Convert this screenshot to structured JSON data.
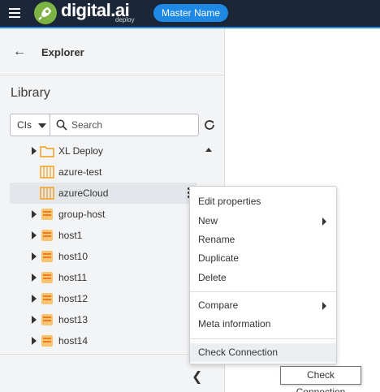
{
  "topbar": {
    "brand": "digital.ai",
    "brand_sub": "deploy",
    "master_name": "Master Name",
    "menu_icon": "hamburger-menu-icon",
    "colors": {
      "bar": "#1b2638",
      "accent": "#1e88e5",
      "brand_green": "#7cb342"
    }
  },
  "explorer": {
    "back_icon": "back-arrow-icon",
    "title": "Explorer"
  },
  "library": {
    "title": "Library",
    "filter_selected": "CIs",
    "search_placeholder": "Search",
    "refresh_icon": "refresh-icon"
  },
  "tree": {
    "items": [
      {
        "label": "XL Deploy",
        "icon": "folder-icon",
        "expandable": true
      },
      {
        "label": "azure-test",
        "icon": "infrastructure-icon",
        "expandable": false
      },
      {
        "label": "azureCloud",
        "icon": "infrastructure-icon",
        "expandable": false,
        "selected": true
      },
      {
        "label": "group-host",
        "icon": "host-icon",
        "expandable": true
      },
      {
        "label": "host1",
        "icon": "host-icon",
        "expandable": true
      },
      {
        "label": "host10",
        "icon": "host-icon",
        "expandable": true
      },
      {
        "label": "host11",
        "icon": "host-icon",
        "expandable": true
      },
      {
        "label": "host12",
        "icon": "host-icon",
        "expandable": true
      },
      {
        "label": "host13",
        "icon": "host-icon",
        "expandable": true
      },
      {
        "label": "host14",
        "icon": "host-icon",
        "expandable": true
      }
    ]
  },
  "context_menu": {
    "items": [
      {
        "label": "Edit properties"
      },
      {
        "label": "New",
        "submenu": true
      },
      {
        "label": "Rename"
      },
      {
        "label": "Duplicate"
      },
      {
        "label": "Delete"
      },
      {
        "label": "Compare",
        "submenu": true
      },
      {
        "label": "Meta information"
      },
      {
        "label": "Check Connection"
      }
    ]
  },
  "tooltip": {
    "text": "Check Connection"
  }
}
